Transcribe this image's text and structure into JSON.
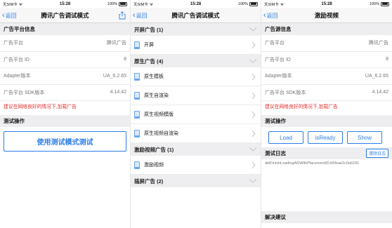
{
  "status": {
    "carrier": "无SIM卡",
    "time": "15:28",
    "battery": "100%"
  },
  "accent_color": "#2b7de9",
  "warning_color": "#e0302c",
  "screen1": {
    "back_label": "返回",
    "title": "腾讯广告调试模式",
    "section_info": "广告平台信息",
    "rows": [
      {
        "key": "广告平台",
        "value": "腾讯广告"
      },
      {
        "key": "广告平台 ID",
        "value": "8"
      },
      {
        "key": "Adapter版本",
        "value": "UA_6.2.65"
      },
      {
        "key": "广告平台 SDK版本",
        "value": "4.14.42"
      }
    ],
    "warning": "建议在网络良好的情况下,加载广告",
    "section_test": "测试操作",
    "test_button": "使用测试模式测试"
  },
  "screen2": {
    "back_label": "返回",
    "title": "腾讯广告调试模式",
    "groups": [
      {
        "title": "开屏广告 (1)",
        "items": [
          "开屏"
        ]
      },
      {
        "title": "原生广告 (4)",
        "items": [
          "原生模板",
          "原生自渲染",
          "原生视频模版",
          "原生视频自渲染"
        ]
      },
      {
        "title": "激励视频广告 (1)",
        "items": [
          "激励视频"
        ]
      },
      {
        "title": "插屏广告 (2)",
        "items": []
      }
    ]
  },
  "screen3": {
    "back_label": "返回",
    "title": "激励视频",
    "section_info": "广告源信息",
    "rows": [
      {
        "key": "广告平台",
        "value": "腾讯广告"
      },
      {
        "key": "广告平台 ID",
        "value": "8"
      },
      {
        "key": "Adapter版本",
        "value": "UA_6.2.65"
      },
      {
        "key": "广告平台 SDK版本",
        "value": "4.14.42"
      }
    ],
    "warning": "建议在网络良好的情况下,加载广告",
    "section_test": "测试操作",
    "buttons": [
      "Load",
      "isReady",
      "Show"
    ],
    "section_log": "测试日志",
    "clear_label": "清除日志",
    "log_line": "didFinishLoadingADWithPlacementID:b5feae2c0a6181",
    "section_suggest": "解决建议"
  }
}
